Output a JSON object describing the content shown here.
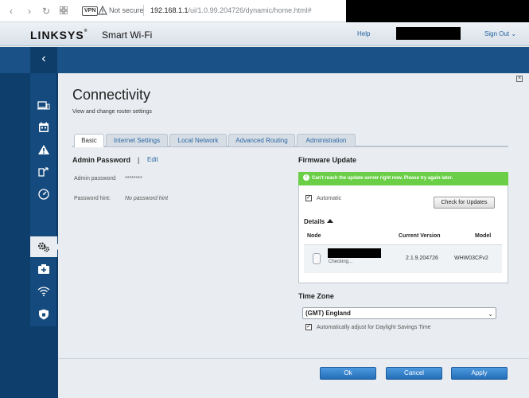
{
  "browser": {
    "vpn_label": "VPN",
    "security_label": "Not secure",
    "url_host": "192.168.1.1",
    "url_path": "/ui/1.0.99.204726/dynamic/home.html#"
  },
  "header": {
    "brand": "LINKSYS",
    "brand_mark": "®",
    "product": "Smart Wi-Fi",
    "help_label": "Help",
    "signout_label": "Sign Out"
  },
  "page": {
    "title": "Connectivity",
    "subtitle": "View and change router settings"
  },
  "tabs": [
    {
      "label": "Basic",
      "active": true
    },
    {
      "label": "Internet Settings",
      "active": false
    },
    {
      "label": "Local Network",
      "active": false
    },
    {
      "label": "Advanced Routing",
      "active": false
    },
    {
      "label": "Administration",
      "active": false
    }
  ],
  "admin": {
    "heading": "Admin Password",
    "separator": "|",
    "edit_label": "Edit",
    "password_label": "Admin password:",
    "password_value": "********",
    "hint_label": "Password hint:",
    "hint_value": "No password hint"
  },
  "firmware": {
    "heading": "Firmware Update",
    "alert_icon": "!",
    "alert_text": "Can't reach the update server right now. Please try again later.",
    "automatic_label": "Automatic",
    "automatic_checked": true,
    "check_button": "Check for Updates",
    "details_label": "Details",
    "columns": {
      "node": "Node",
      "version": "Current Version",
      "model": "Model"
    },
    "node": {
      "status": "Checking...",
      "version": "2.1.9.204726",
      "model": "WHW03CFv2"
    }
  },
  "timezone": {
    "heading": "Time Zone",
    "selected": "(GMT) England",
    "dst_label": "Automatically adjust for Daylight Savings Time",
    "dst_checked": true
  },
  "footer": {
    "ok_label": "Ok",
    "cancel_label": "Cancel",
    "apply_label": "Apply"
  },
  "colors": {
    "accent_blue": "#2c68a3",
    "alert_green": "#6acf47",
    "sidebar_blue": "#144a7e"
  },
  "sidebar_icons": [
    "devices-icon",
    "calendar-icon",
    "alert-triangle-icon",
    "share-icon",
    "speedometer-icon",
    "gear-icon",
    "camera-plus-icon",
    "wifi-icon",
    "shield-icon"
  ]
}
